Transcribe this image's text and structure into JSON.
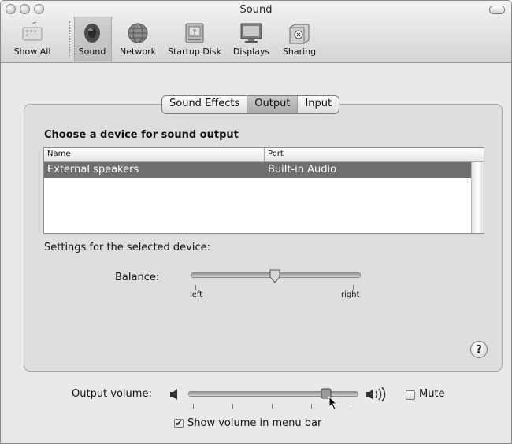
{
  "window": {
    "title": "Sound"
  },
  "toolbar": {
    "items": [
      {
        "label": "Show All"
      },
      {
        "label": "Sound"
      },
      {
        "label": "Network"
      },
      {
        "label": "Startup Disk"
      },
      {
        "label": "Displays"
      },
      {
        "label": "Sharing"
      }
    ],
    "selected": "Sound"
  },
  "tabs": {
    "items": [
      "Sound Effects",
      "Output",
      "Input"
    ],
    "selected": "Output"
  },
  "output": {
    "heading": "Choose a device for sound output",
    "columns": [
      "Name",
      "Port"
    ],
    "rows": [
      {
        "name": "External speakers",
        "port": "Built-in Audio"
      }
    ],
    "selected_row": 0,
    "settings_label": "Settings for the selected device:",
    "balance": {
      "label": "Balance:",
      "left_label": "left",
      "right_label": "right",
      "value": 0.5
    }
  },
  "help": {
    "symbol": "?"
  },
  "volume": {
    "label": "Output volume:",
    "value": 0.82,
    "mute_label": "Mute",
    "mute_checked": false,
    "show_in_menubar_label": "Show volume in menu bar",
    "show_in_menubar_checked": true
  },
  "colors": {
    "selection": "#6f6f6f",
    "window": "#e9e9e9"
  }
}
